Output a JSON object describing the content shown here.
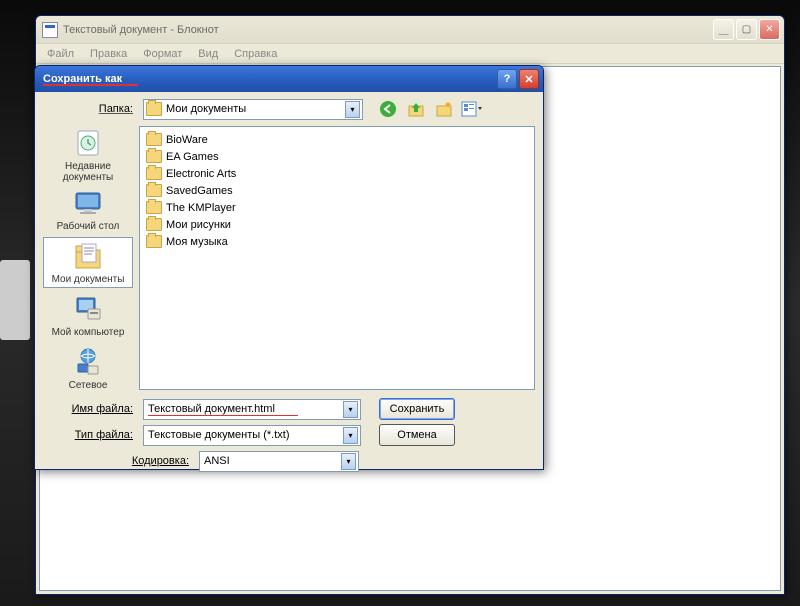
{
  "main_window": {
    "title": "Текстовый документ - Блокнот",
    "menu": {
      "file": "Файл",
      "edit": "Правка",
      "format": "Формат",
      "view": "Вид",
      "help": "Справка"
    }
  },
  "dialog": {
    "title": "Сохранить как",
    "path_label": "Папка:",
    "path_value": "Мои документы",
    "places": {
      "recent": "Недавние документы",
      "desktop": "Рабочий стол",
      "mydocs": "Мои документы",
      "mycomputer": "Мой компьютер",
      "network": "Сетевое"
    },
    "folders": [
      "BioWare",
      "EA Games",
      "Electronic Arts",
      "SavedGames",
      "The KMPlayer",
      "Мои рисунки",
      "Моя музыка"
    ],
    "filename_label": "Имя файла:",
    "filename_value": "Текстовый документ.html",
    "filetype_label": "Тип файла:",
    "filetype_value": "Текстовые документы (*.txt)",
    "encoding_label": "Кодировка:",
    "encoding_value": "ANSI",
    "save_btn": "Сохранить",
    "cancel_btn": "Отмена"
  }
}
